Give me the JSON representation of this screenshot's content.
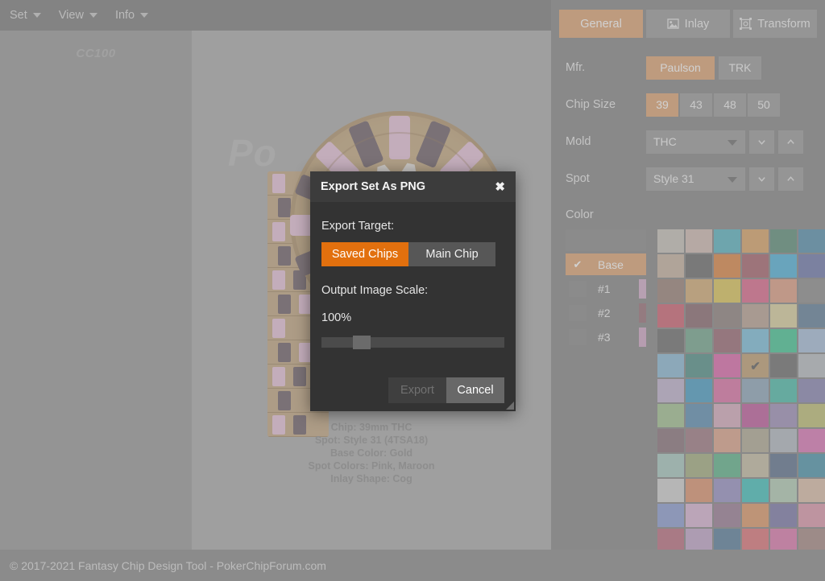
{
  "menubar": {
    "items": [
      {
        "label": "Set",
        "icon": "chevron-down-icon"
      },
      {
        "label": "View",
        "icon": "chevron-down-icon"
      },
      {
        "label": "Info",
        "icon": "chevron-down-icon"
      }
    ]
  },
  "saved_chips_panel": {
    "label": "CC100"
  },
  "canvas": {
    "watermark": "Po",
    "chip_info": [
      "Chip:  39mm  THC",
      "Spot:  Style 31 (4TSA18)",
      "Base Color:  Gold",
      "Spot Colors:  Pink, Maroon",
      "Inlay Shape:  Cog"
    ],
    "chip_render": {
      "base_color": "#c4a87f",
      "spot_colors": [
        "#e8c3da",
        "#6f6068"
      ],
      "inlay_color": "#efe9e4",
      "inlay_shape": "Cog"
    }
  },
  "rightpanel": {
    "tabs": [
      {
        "label": "General",
        "icon": "general-icon",
        "active": true
      },
      {
        "label": "Inlay",
        "icon": "image-icon",
        "active": false
      },
      {
        "label": "Transform",
        "icon": "transform-icon",
        "active": false
      }
    ],
    "mfr": {
      "label": "Mfr.",
      "options": [
        {
          "label": "Paulson",
          "selected": true
        },
        {
          "label": "TRK",
          "selected": false
        }
      ]
    },
    "chip_size": {
      "label": "Chip Size",
      "options": [
        {
          "label": "39",
          "selected": true
        },
        {
          "label": "43",
          "selected": false
        },
        {
          "label": "48",
          "selected": false
        },
        {
          "label": "50",
          "selected": false
        }
      ]
    },
    "mold": {
      "label": "Mold",
      "value": "THC",
      "prev_icon": "chevron-down-icon",
      "next_icon": "chevron-up-icon"
    },
    "spot": {
      "label": "Spot",
      "value": "Style 31",
      "prev_icon": "chevron-down-icon",
      "next_icon": "chevron-up-icon"
    },
    "color": {
      "label": "Color",
      "slots": [
        {
          "label": "",
          "selected": false,
          "checked": false,
          "strip": ""
        },
        {
          "label": "Base",
          "selected": true,
          "checked": true,
          "strip": ""
        },
        {
          "label": "#1",
          "selected": false,
          "checked": false,
          "strip": "#d4aecb"
        },
        {
          "label": "#2",
          "selected": false,
          "checked": false,
          "strip": "#9a7179"
        },
        {
          "label": "#3",
          "selected": false,
          "checked": false,
          "strip": "#d3a9c8"
        }
      ],
      "selected_swatch_index": 33,
      "swatches": [
        "#c9c3bb",
        "#d2bdb4",
        "#5bb6c4",
        "#dda568",
        "#5e8f7b",
        "#5791b0",
        "#c8b4a2",
        "#6d6d6d",
        "#e08845",
        "#a9646e",
        "#52b4dd",
        "#707aae",
        "#9c8378",
        "#d6ad77",
        "#dfc95a",
        "#e0698e",
        "#e2a186",
        "#8e8e8e",
        "#d06374",
        "#8a6a71",
        "#8f837f",
        "#bba394",
        "#ddd3a1",
        "#63809c",
        "#6e6e6e",
        "#75a990",
        "#9c6a76",
        "#7ec2de",
        "#45c996",
        "#a9c0dd",
        "#8dbbd8",
        "#529189",
        "#e069ae",
        "#c2a173",
        "#6f6f6f",
        "#b9bec3",
        "#c2b4d0",
        "#4a9fc6",
        "#e073a8",
        "#8fa8bd",
        "#4dbeac",
        "#8a87b4",
        "#a4c493",
        "#5e90b4",
        "#d9aec0",
        "#c25d9f",
        "#a091bb",
        "#c2c177",
        "#8a747c",
        "#a07a84",
        "#e0a58c",
        "#b2ac97",
        "#b4bbc4",
        "#de79ba",
        "#a8cac1",
        "#a6b080",
        "#5fb68d",
        "#c6bfa5",
        "#5f7490",
        "#4d96ae",
        "#d2d2d2",
        "#df9571",
        "#9a93c6",
        "#43c4bf",
        "#b4cfb7",
        "#dec0aa",
        "#8e9ed4",
        "#dbb6d6",
        "#9c7e96",
        "#e09a6a",
        "#7d7aab",
        "#e09aae",
        "#bd6f80",
        "#c4a7cb",
        "#5b7f9d",
        "#e0767a",
        "#e07ab0",
        "#a88a85"
      ]
    }
  },
  "dialog": {
    "title": "Export Set As PNG",
    "close_icon": "close-icon",
    "target_label": "Export Target:",
    "target_options": [
      {
        "label": "Saved Chips",
        "selected": true
      },
      {
        "label": "Main Chip",
        "selected": false
      }
    ],
    "scale_label": "Output Image Scale:",
    "scale_value": "100%",
    "slider_percent": 17,
    "buttons": [
      {
        "label": "Export",
        "disabled": true
      },
      {
        "label": "Cancel",
        "disabled": false
      }
    ],
    "resize_grip_icon": "resize-grip-icon"
  },
  "footer": {
    "text": "© 2017-2021 Fantasy Chip Design Tool - PokerChipForum.com"
  },
  "colors": {
    "accent_orange": "#e2700e",
    "tab_active": "#e0a675",
    "panel_bg": "#878787",
    "canvas_bg": "#acacac",
    "dialog_bg": "#333333"
  }
}
